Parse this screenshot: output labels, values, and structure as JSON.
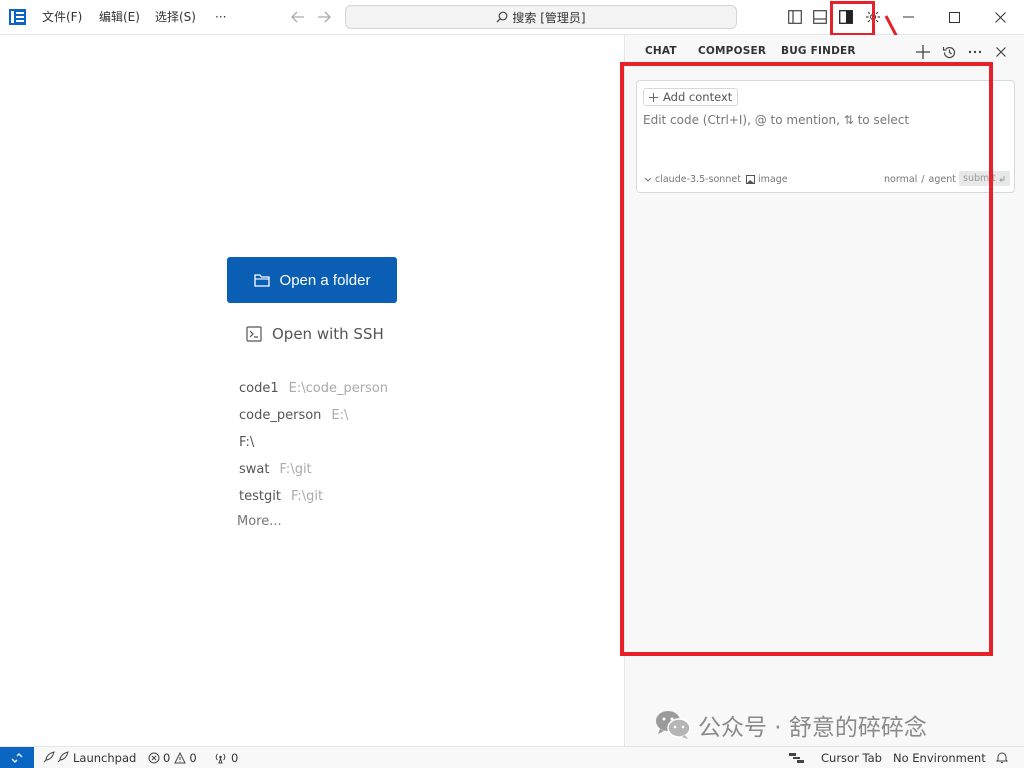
{
  "titlebar": {
    "menus": [
      "文件(F)",
      "编辑(E)",
      "选择(S)",
      "···"
    ],
    "search_text": "搜索 [管理员]"
  },
  "welcome": {
    "open_folder_label": "Open a folder",
    "open_ssh_label": "Open with SSH",
    "recent": [
      {
        "name": "code1",
        "path": "E:\\code_person"
      },
      {
        "name": "code_person",
        "path": "E:\\"
      },
      {
        "name": "F:\\",
        "path": ""
      },
      {
        "name": "swat",
        "path": "F:\\git"
      },
      {
        "name": "testgit",
        "path": "F:\\git"
      }
    ],
    "more_label": "More..."
  },
  "panel": {
    "tabs": [
      "CHAT",
      "COMPOSER",
      "BUG FINDER"
    ],
    "add_context_label": "Add context",
    "input_placeholder": "Edit code (Ctrl+I), @ to mention, ⇅ to select",
    "model": "claude-3.5-sonnet",
    "image_label": "image",
    "mode_normal": "normal",
    "mode_sep": "/",
    "mode_agent": "agent",
    "submit_label": "submit"
  },
  "watermark": "公众号 · 舒意的碎碎念",
  "statusbar": {
    "launchpad": "Launchpad",
    "errors": "0",
    "warnings": "0",
    "ports": "0",
    "cursor_tab": "Cursor Tab",
    "environment": "No Environment"
  },
  "colors": {
    "accent": "#0a5fb4",
    "annotation": "#e6212a",
    "remote": "#0a66c2"
  }
}
